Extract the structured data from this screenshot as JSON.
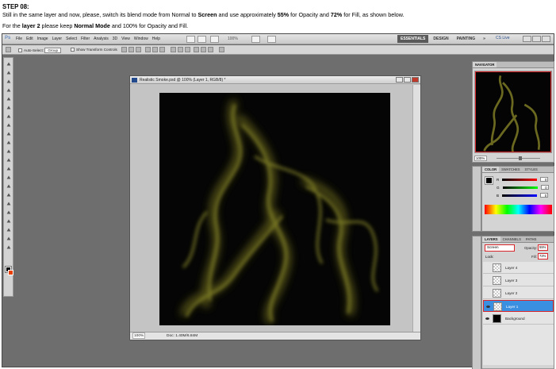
{
  "instruction": {
    "step_title": "STEP 08:",
    "line1_a": "Still in the same layer and now, please, switch its blend mode from Normal to ",
    "line1_b": "Screen",
    "line1_c": " and use approximately ",
    "line1_d": "55%",
    "line1_e": " for Opacity and ",
    "line1_f": "72%",
    "line1_g": " for Fill, as shown below.",
    "line2_a": "For the ",
    "line2_b": "layer 2",
    "line2_c": " please keep ",
    "line2_d": "Normal Mode",
    "line2_e": " and 100% for Opacity and Fill."
  },
  "menubar": {
    "logo": "Ps",
    "items": [
      "File",
      "Edit",
      "Image",
      "Layer",
      "Select",
      "Filter",
      "Analysis",
      "3D",
      "View",
      "Window",
      "Help"
    ],
    "zoom": "100%",
    "workspaces": [
      "ESSENTIALS",
      "DESIGN",
      "PAINTING"
    ],
    "more": "»",
    "cs_live": "CS Live"
  },
  "options": {
    "auto_select": "Auto-Select:",
    "auto_select_value": "Group",
    "show_transform": "Show Transform Controls"
  },
  "document": {
    "title": "Realistic Smoke.psd @ 100% (Layer 1, RGB/8) *",
    "zoom": "100%",
    "doc_size": "Doc: 1.40M/6.84M"
  },
  "navigator": {
    "tab": "NAVIGATOR",
    "zoom": "100%"
  },
  "color_panel": {
    "tabs": [
      "COLOR",
      "SWATCHES",
      "STYLES"
    ],
    "channels": [
      {
        "label": "R",
        "value": "0"
      },
      {
        "label": "G",
        "value": "0"
      },
      {
        "label": "B",
        "value": "0"
      }
    ]
  },
  "layers_panel": {
    "tabs": [
      "LAYERS",
      "CHANNELS",
      "PATHS"
    ],
    "blend_mode": "Screen",
    "opacity_label": "Opacity:",
    "opacity": "55%",
    "lock_label": "Lock:",
    "fill_label": "Fill:",
    "fill": "72%",
    "layers": [
      {
        "name": "Layer 4",
        "visible": false,
        "selected": false,
        "thumb": "trans"
      },
      {
        "name": "Layer 3",
        "visible": false,
        "selected": false,
        "thumb": "trans"
      },
      {
        "name": "Layer 2",
        "visible": false,
        "selected": false,
        "thumb": "trans"
      },
      {
        "name": "Layer 1",
        "visible": true,
        "selected": true,
        "thumb": "trans"
      },
      {
        "name": "Background",
        "visible": true,
        "selected": false,
        "thumb": "blk"
      }
    ]
  },
  "colors": {
    "highlight": "#d8262a",
    "selection": "#3b8fe0",
    "smoke": "#8a8a2a"
  }
}
